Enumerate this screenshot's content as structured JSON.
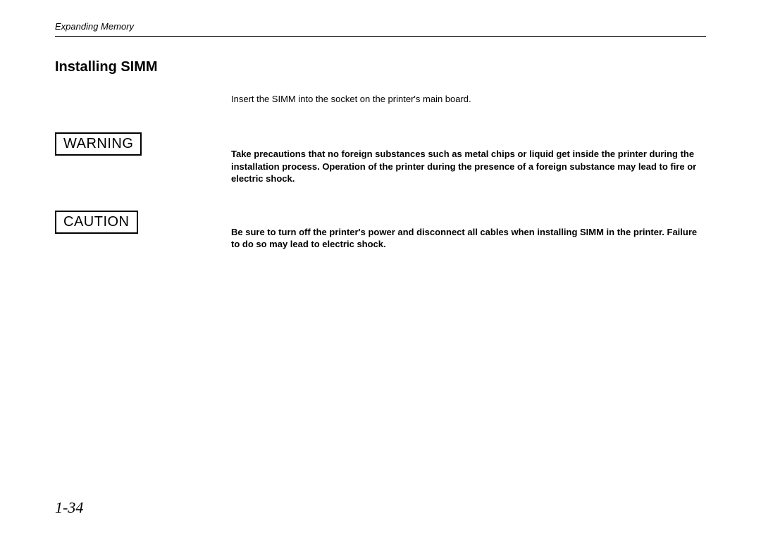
{
  "header": {
    "chapter": "Expanding Memory"
  },
  "section": {
    "title": "Installing SIMM",
    "intro": "Insert the SIMM into the socket on the printer's main board."
  },
  "warning": {
    "label": "WARNING",
    "text": "Take precautions that no foreign substances such as metal chips or liquid get inside the printer during the installation process.  Operation of the printer during the presence of a foreign substance may lead to fire or electric shock."
  },
  "caution": {
    "label": "CAUTION",
    "text": "Be sure to turn off the printer's power and disconnect all cables when installing SIMM in the printer.  Failure to do so may lead to electric shock."
  },
  "page_number": "1-34"
}
